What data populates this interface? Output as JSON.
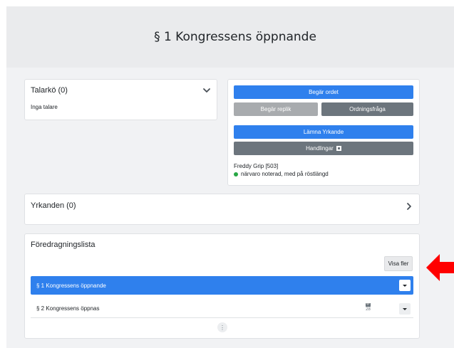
{
  "header": {
    "title": "§ 1 Kongressens öppnande"
  },
  "talarko": {
    "title": "Talarkö (0)",
    "empty_text": "Inga talare",
    "toggle_icon": "chevron-down-icon"
  },
  "actions": {
    "request_floor": "Begär ordet",
    "request_reply": "Begär replik",
    "point_of_order": "Ordningsfråga",
    "submit_motion": "Lämna Yrkande",
    "documents": "Handlingar",
    "user": "Freddy Grip  [503]",
    "presence": "närvaro noterad, med på röstlängd"
  },
  "yrkanden": {
    "title": "Yrkanden (0)",
    "toggle_icon": "chevron-right-icon"
  },
  "agenda": {
    "title": "Föredragningslista",
    "show_more": "Visa fler",
    "items": [
      {
        "label": "§ 1 Kongressens öppnande",
        "active": true
      },
      {
        "label": "§ 2 Kongressens öppnas",
        "active": false,
        "attachments": "28"
      }
    ],
    "more_icon": "vertical-ellipsis-icon"
  },
  "colors": {
    "primary": "#2f80ed",
    "secondary": "#6c757d",
    "disabled": "#a8abae",
    "presence": "#28a745",
    "arrow": "#ff0000"
  }
}
